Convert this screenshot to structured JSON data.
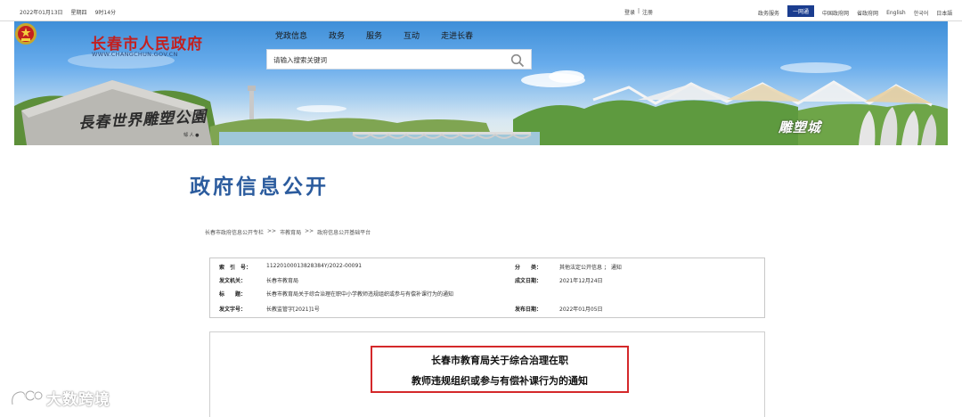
{
  "topbar": {
    "date": "2022年01月13日",
    "weekday": "星期四",
    "time": "9时14分",
    "login": "登录",
    "separator": "|",
    "register": "注册",
    "links": [
      "政务服务",
      "一网通",
      "中国政府网",
      "省政府网",
      "English",
      "한국어",
      "日本語"
    ]
  },
  "header": {
    "site_title": "长春市人民政府",
    "site_url": "WWW.CHANGCHUN.GOV.CN",
    "nav": [
      "党政信息",
      "政务",
      "服务",
      "互动",
      "走进长春"
    ],
    "search_placeholder": "请输入搜索关键词",
    "stone_inscription": "長春世界雕塑公園",
    "stone_small": "邹 人 ●",
    "sculpture_city": "雕塑城"
  },
  "page": {
    "heading": "政府信息公开",
    "breadcrumb": [
      "长春市政府信息公开专栏",
      ">>",
      "市教育局",
      ">>",
      "政府信息公开基础平台"
    ]
  },
  "info": {
    "index_label": "索　引　号：",
    "index_value": "11220100013828384Y/2022-00091",
    "category_label": "分　　类：",
    "category_value": "其他法定公开信息 ； 通知",
    "issuer_label": "发文机关：",
    "issuer_value": "长春市教育局",
    "created_label": "成文日期：",
    "created_value": "2021年12月24日",
    "title_label": "标　　题：",
    "title_value": "长春市教育局关于综合治理在职中小学教师违规组织或参与有偿补课行为的通知",
    "docno_label": "发文字号：",
    "docno_value": "长教监管字[2021]1号",
    "published_label": "发布日期：",
    "published_value": "2022年01月05日"
  },
  "document": {
    "title_line1": "长春市教育局关于综合治理在职",
    "title_line2": "教师违规组织或参与有偿补课行为的通知"
  },
  "watermark": {
    "text": "大数跨境"
  },
  "colors": {
    "brand_red": "#c3201f",
    "heading_blue": "#2c5c9e",
    "active_nav": "#1b3d8f",
    "highlight_border": "#d4282a"
  }
}
